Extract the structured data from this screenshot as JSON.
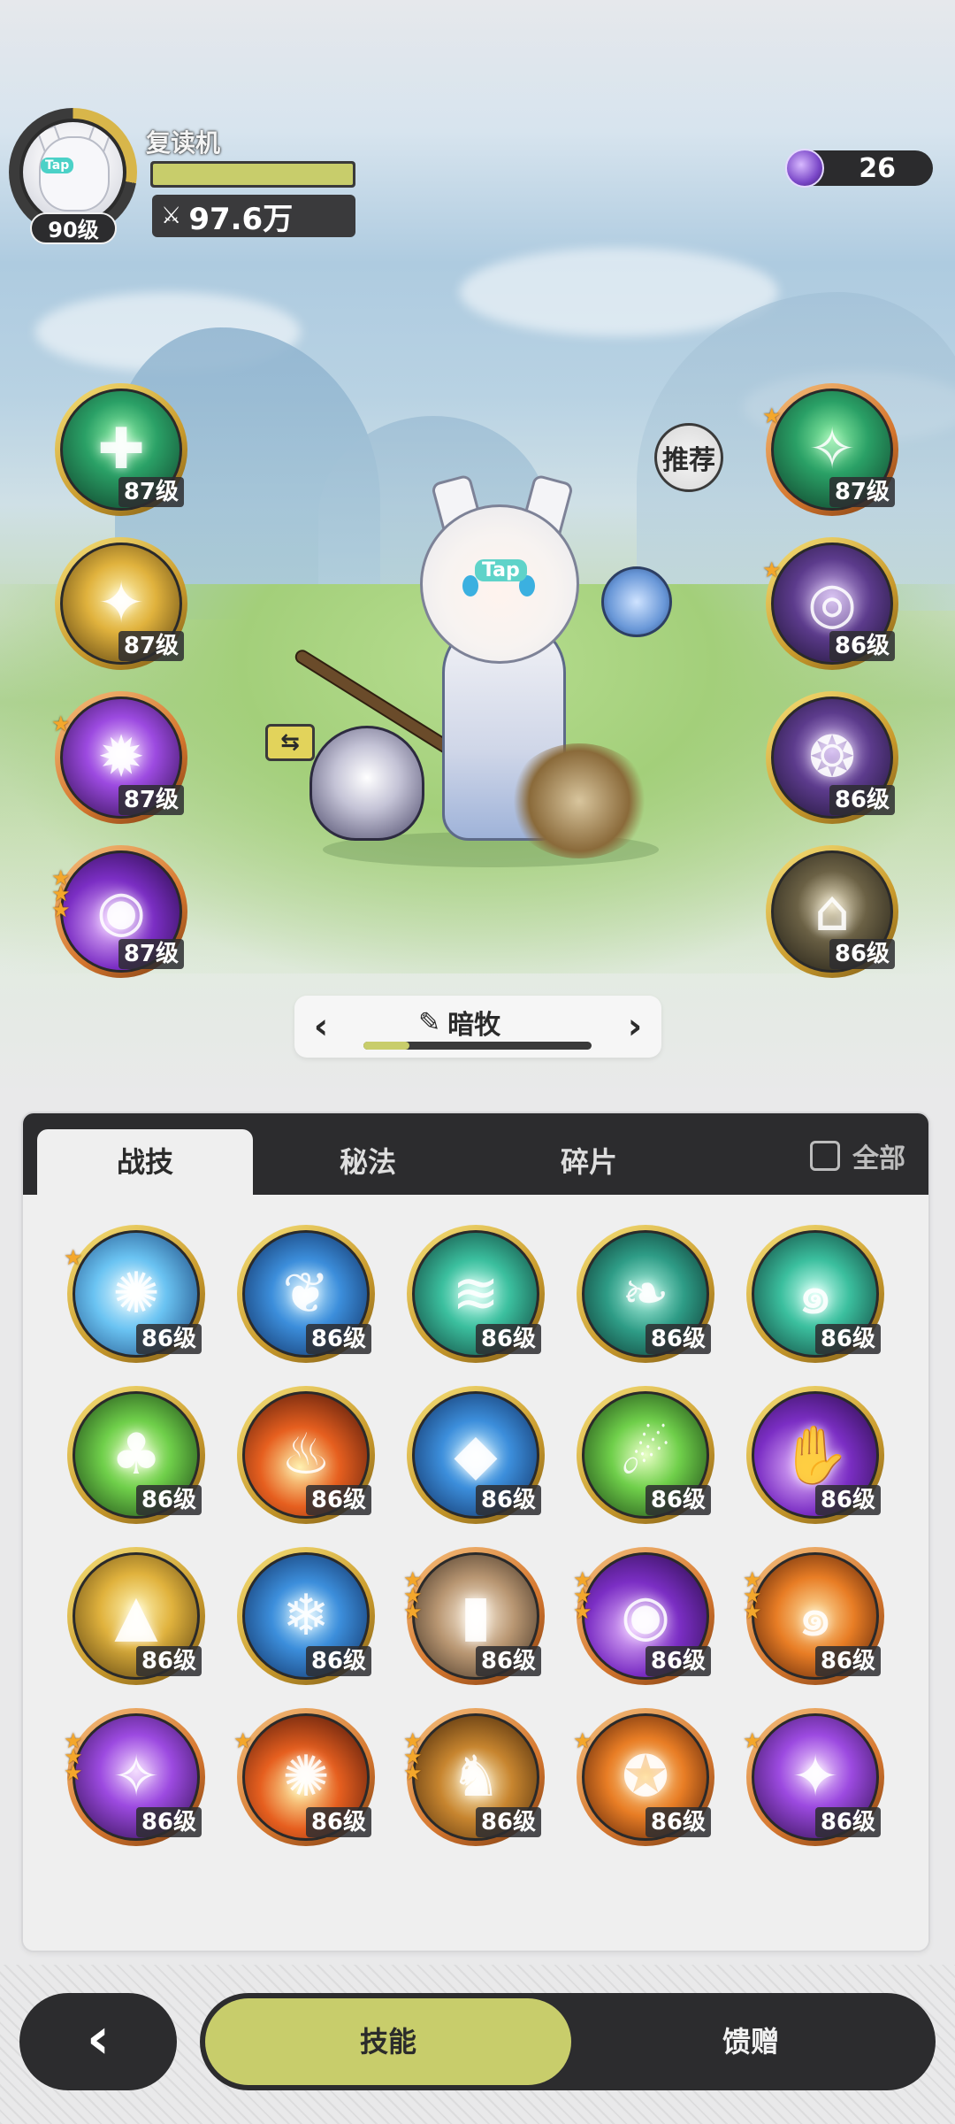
{
  "player": {
    "name": "复读机",
    "level": "90级",
    "power": "97.6万",
    "avatar_tag": "Tap",
    "xp_progress": 1.0
  },
  "currency": {
    "value": "26",
    "icon": "purple-gem-icon"
  },
  "recommend_label": "推荐",
  "character_tag": "Tap",
  "pet_swap_icon": "swap-arrows-icon",
  "left_skills": [
    {
      "level": "87级",
      "stars": 0,
      "icon": "green-sparkle-icon",
      "color": "green",
      "ring": "gold"
    },
    {
      "level": "87级",
      "stars": 0,
      "icon": "golden-sparkle-icon",
      "color": "gold",
      "ring": "gold"
    },
    {
      "level": "87级",
      "stars": 1,
      "icon": "purple-burst-icon",
      "color": "purple",
      "ring": "orange"
    },
    {
      "level": "87级",
      "stars": 3,
      "icon": "violet-orb-icon",
      "color": "violet",
      "ring": "orange"
    }
  ],
  "right_skills": [
    {
      "level": "87级",
      "stars": 1,
      "icon": "green-star-icon",
      "color": "green",
      "ring": "orange"
    },
    {
      "level": "86级",
      "stars": 1,
      "icon": "purple-eye-icon",
      "color": "darkpurple",
      "ring": "gold"
    },
    {
      "level": "86级",
      "stars": 0,
      "icon": "purple-sigil-icon",
      "color": "darkpurple",
      "ring": "gold"
    },
    {
      "level": "86级",
      "stars": 0,
      "icon": "dark-ring-icon",
      "color": "dark",
      "ring": "gold"
    }
  ],
  "switcher": {
    "class_name": "暗牧",
    "edit_icon": "pencil-icon",
    "prev_icon": "chevron-left-icon",
    "next_icon": "chevron-right-icon",
    "progress": 0.2
  },
  "tabs": [
    {
      "label": "战技",
      "active": true
    },
    {
      "label": "秘法",
      "active": false
    },
    {
      "label": "碎片",
      "active": false
    }
  ],
  "all_toggle_label": "全部",
  "skill_grid": [
    {
      "level": "86级",
      "stars": 1,
      "icon": "ice-shatter-icon",
      "color": "ice",
      "ring": "gold"
    },
    {
      "level": "86级",
      "stars": 0,
      "icon": "water-flame-icon",
      "color": "blue",
      "ring": "gold"
    },
    {
      "level": "86级",
      "stars": 0,
      "icon": "wind-slash-icon",
      "color": "teal",
      "ring": "gold"
    },
    {
      "level": "86级",
      "stars": 0,
      "icon": "thorn-vine-icon",
      "color": "teal2",
      "ring": "gold"
    },
    {
      "level": "86级",
      "stars": 0,
      "icon": "whirlwind-icon",
      "color": "teal",
      "ring": "gold"
    },
    {
      "level": "86级",
      "stars": 0,
      "icon": "nature-totem-icon",
      "color": "lime",
      "ring": "gold"
    },
    {
      "level": "86级",
      "stars": 0,
      "icon": "fire-icon",
      "color": "fire",
      "ring": "gold"
    },
    {
      "level": "86级",
      "stars": 0,
      "icon": "ice-crystal-icon",
      "color": "blue",
      "ring": "gold"
    },
    {
      "level": "86级",
      "stars": 0,
      "icon": "green-comet-icon",
      "color": "lime",
      "ring": "gold"
    },
    {
      "level": "86级",
      "stars": 0,
      "icon": "shadow-hand-icon",
      "color": "violet",
      "ring": "gold"
    },
    {
      "level": "86级",
      "stars": 0,
      "icon": "golden-crystal-icon",
      "color": "gold",
      "ring": "gold"
    },
    {
      "level": "86级",
      "stars": 0,
      "icon": "frost-beast-icon",
      "color": "blue",
      "ring": "gold"
    },
    {
      "level": "86级",
      "stars": 3,
      "icon": "card-fan-icon",
      "color": "sand",
      "ring": "orange"
    },
    {
      "level": "86级",
      "stars": 3,
      "icon": "void-eye-icon",
      "color": "violet",
      "ring": "orange"
    },
    {
      "level": "86级",
      "stars": 3,
      "icon": "fire-swirl-icon",
      "color": "orange",
      "ring": "orange"
    },
    {
      "level": "86级",
      "stars": 3,
      "icon": "arcane-diamond-icon",
      "color": "purple",
      "ring": "orange"
    },
    {
      "level": "86级",
      "stars": 1,
      "icon": "fire-vortex-icon",
      "color": "fire",
      "ring": "orange"
    },
    {
      "level": "86级",
      "stars": 3,
      "icon": "flame-wolf-icon",
      "color": "amber",
      "ring": "orange"
    },
    {
      "level": "86级",
      "stars": 1,
      "icon": "flame-crest-icon",
      "color": "orange",
      "ring": "orange"
    },
    {
      "level": "86级",
      "stars": 1,
      "icon": "star-burst-icon",
      "color": "purple",
      "ring": "orange"
    }
  ],
  "bottom_nav": {
    "back_icon": "chevron-left-icon",
    "skill_label": "技能",
    "gift_label": "馈赠"
  }
}
